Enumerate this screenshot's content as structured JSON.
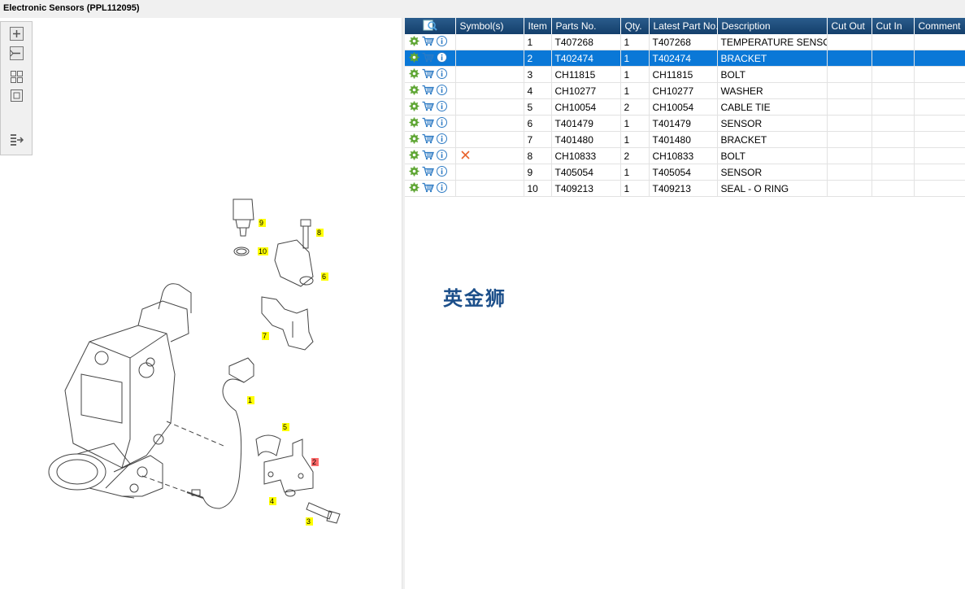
{
  "window": {
    "title": "Electronic Sensors (PPL112095)"
  },
  "toolbar": {
    "buttons": [
      "zoom-in",
      "zoom-out",
      "fit-all",
      "fit-window",
      "export"
    ]
  },
  "table": {
    "columns": [
      "",
      "Symbol(s)",
      "Item",
      "Parts No.",
      "Qty.",
      "Latest Part No.",
      "Description",
      "Cut Out",
      "Cut In",
      "Comment"
    ],
    "selected_index": 1,
    "rows": [
      {
        "symbol": "",
        "item": "1",
        "part": "T407268",
        "qty": "1",
        "latest": "T407268",
        "desc": "TEMPERATURE SENSOR",
        "cut_out": "",
        "cut_in": "",
        "comment": ""
      },
      {
        "symbol": "",
        "item": "2",
        "part": "T402474",
        "qty": "1",
        "latest": "T402474",
        "desc": "BRACKET",
        "cut_out": "",
        "cut_in": "",
        "comment": ""
      },
      {
        "symbol": "",
        "item": "3",
        "part": "CH11815",
        "qty": "1",
        "latest": "CH11815",
        "desc": "BOLT",
        "cut_out": "",
        "cut_in": "",
        "comment": ""
      },
      {
        "symbol": "",
        "item": "4",
        "part": "CH10277",
        "qty": "1",
        "latest": "CH10277",
        "desc": "WASHER",
        "cut_out": "",
        "cut_in": "",
        "comment": ""
      },
      {
        "symbol": "",
        "item": "5",
        "part": "CH10054",
        "qty": "2",
        "latest": "CH10054",
        "desc": "CABLE TIE",
        "cut_out": "",
        "cut_in": "",
        "comment": ""
      },
      {
        "symbol": "",
        "item": "6",
        "part": "T401479",
        "qty": "1",
        "latest": "T401479",
        "desc": "SENSOR",
        "cut_out": "",
        "cut_in": "",
        "comment": ""
      },
      {
        "symbol": "",
        "item": "7",
        "part": "T401480",
        "qty": "1",
        "latest": "T401480",
        "desc": "BRACKET",
        "cut_out": "",
        "cut_in": "",
        "comment": ""
      },
      {
        "symbol": "x-icon",
        "item": "8",
        "part": "CH10833",
        "qty": "2",
        "latest": "CH10833",
        "desc": "BOLT",
        "cut_out": "",
        "cut_in": "",
        "comment": ""
      },
      {
        "symbol": "",
        "item": "9",
        "part": "T405054",
        "qty": "1",
        "latest": "T405054",
        "desc": "SENSOR",
        "cut_out": "",
        "cut_in": "",
        "comment": ""
      },
      {
        "symbol": "",
        "item": "10",
        "part": "T409213",
        "qty": "1",
        "latest": "T409213",
        "desc": "SEAL - O RING",
        "cut_out": "",
        "cut_in": "",
        "comment": ""
      }
    ]
  },
  "diagram": {
    "callouts": [
      "1",
      "2",
      "3",
      "4",
      "5",
      "6",
      "7",
      "8",
      "9",
      "10"
    ],
    "highlighted": "2"
  },
  "watermark": "英金狮",
  "colors": {
    "header": "#1f4e79",
    "selected_row": "#0a78d7",
    "callout": "#ffff00",
    "callout_selected": "#ff6b6b"
  }
}
